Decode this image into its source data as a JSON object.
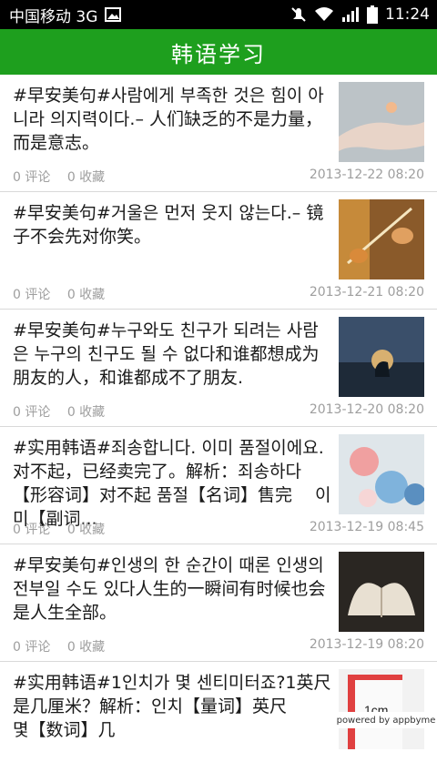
{
  "status_bar": {
    "carrier": "中国移动 3G",
    "time": "11:24"
  },
  "header": {
    "title": "韩语学习"
  },
  "items": [
    {
      "text": "#早安美句#사람에게 부족한 것은 힘이 아니라 의지력이다.– 人们缺乏的不是力量，而是意志。",
      "comments": "0 评论",
      "favorites": "0 收藏",
      "date": "2013-12-22 08:20"
    },
    {
      "text": "#早安美句#거울은 먼저 웃지 않는다.– 镜子不会先对你笑。",
      "comments": "0 评论",
      "favorites": "0 收藏",
      "date": "2013-12-21 08:20"
    },
    {
      "text": "#早安美句#누구와도 친구가 되려는 사람은 누구의 친구도 될 수 없다和谁都想成为朋友的人，和谁都成不了朋友.",
      "comments": "0 评论",
      "favorites": "0 收藏",
      "date": "2013-12-20 08:20"
    },
    {
      "text": "#实用韩语#죄송합니다. 이미 품절이에요.对不起，已经卖完了。解析：죄송하다【形容词】对不起 품절【名词】售完　 이미【副词...",
      "comments": "0 评论",
      "favorites": "0 收藏",
      "date": "2013-12-19 08:45"
    },
    {
      "text": "#早安美句#인생의 한 순간이 때론 인생의 전부일 수도 있다人生的一瞬间有时候也会是人生全部。",
      "comments": "0 评论",
      "favorites": "0 收藏",
      "date": "2013-12-19 08:20"
    },
    {
      "text": "#实用韩语#1인치가 몇 센티미터죠?1英尺是几厘米？解析：인치【量词】英尺　　몇【数词】几",
      "comments": "",
      "favorites": "",
      "date": ""
    }
  ],
  "thumb_caption": "1cm",
  "powered_by": "powered by appbyme"
}
